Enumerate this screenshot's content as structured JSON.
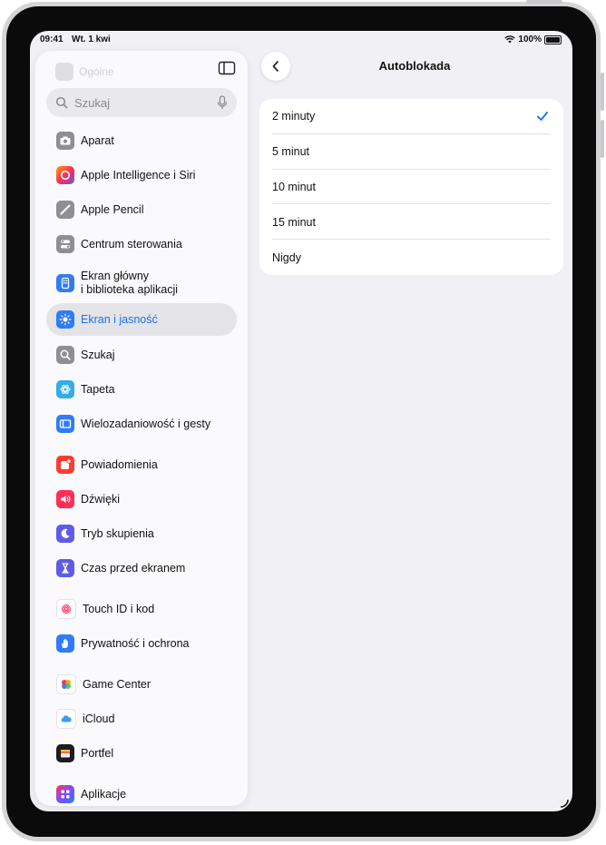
{
  "status_bar": {
    "time": "09:41",
    "date": "Wt. 1 kwi",
    "battery": "100%"
  },
  "sidebar": {
    "top_hidden_label": "Ogólne",
    "search": {
      "placeholder": "Szukaj"
    },
    "items": [
      {
        "label": "Aparat",
        "icon": "camera-icon",
        "color": "#8e8e93"
      },
      {
        "label": "Apple Intelligence i Siri",
        "icon": "apple-intelligence-icon",
        "color": "#f25c8a"
      },
      {
        "label": "Apple Pencil",
        "icon": "pencil-icon",
        "color": "#8e8e93"
      },
      {
        "label": "Centrum sterowania",
        "icon": "control-center-icon",
        "color": "#8e8e93"
      },
      {
        "label": "Ekran główny\ni biblioteka aplikacji",
        "line1": "Ekran główny",
        "line2": "i biblioteka aplikacji",
        "icon": "home-screen-icon",
        "color": "#2f7cf6"
      },
      {
        "label": "Ekran i jasność",
        "icon": "brightness-icon",
        "color": "#2f7cf6",
        "selected": true
      },
      {
        "label": "Szukaj",
        "icon": "search-icon",
        "color": "#8e8e93"
      },
      {
        "label": "Tapeta",
        "icon": "wallpaper-icon",
        "color": "#32ade6"
      },
      {
        "label": "Wielozadaniowość i gesty",
        "icon": "multitasking-icon",
        "color": "#2f7cf6"
      },
      {
        "label": "Powiadomienia",
        "icon": "notifications-icon",
        "color": "#ff3b30"
      },
      {
        "label": "Dźwięki",
        "icon": "sounds-icon",
        "color": "#ff2d55"
      },
      {
        "label": "Tryb skupienia",
        "icon": "focus-icon",
        "color": "#5e5ce6"
      },
      {
        "label": "Czas przed ekranem",
        "icon": "screen-time-icon",
        "color": "#5e5ce6"
      },
      {
        "label": "Touch ID i kod",
        "icon": "fingerprint-icon",
        "color": "#ffffff"
      },
      {
        "label": "Prywatność i ochrona",
        "icon": "privacy-hand-icon",
        "color": "#2f7cf6"
      },
      {
        "label": "Game Center",
        "icon": "game-center-icon",
        "color": "#ffffff"
      },
      {
        "label": "iCloud",
        "icon": "icloud-icon",
        "color": "#ffffff"
      },
      {
        "label": "Portfel",
        "icon": "wallet-icon",
        "color": "#1c1c1e"
      },
      {
        "label": "Aplikacje",
        "icon": "apps-icon",
        "color": "#7d4cff"
      }
    ]
  },
  "main": {
    "title": "Autoblokada",
    "options": [
      {
        "label": "2 minuty",
        "checked": true
      },
      {
        "label": "5 minut",
        "checked": false
      },
      {
        "label": "10 minut",
        "checked": false
      },
      {
        "label": "15 minut",
        "checked": false
      },
      {
        "label": "Nigdy",
        "checked": false
      }
    ]
  },
  "colors": {
    "accent": "#1a73e8",
    "selection": "#e3e3e8",
    "background": "#f1f1f5"
  }
}
